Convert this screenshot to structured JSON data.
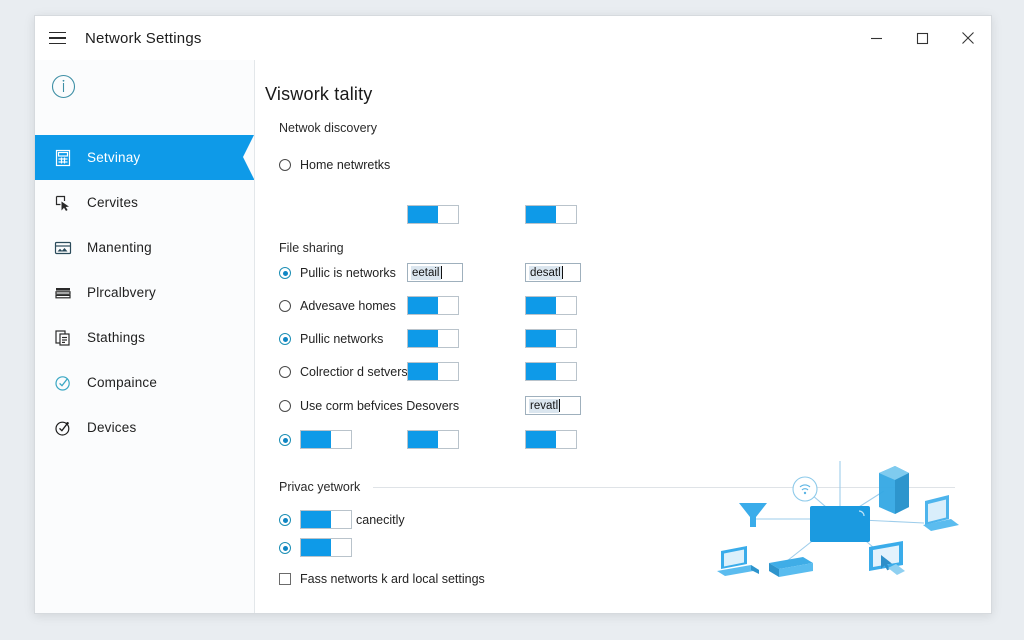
{
  "window": {
    "title": "Network Settings",
    "menu_icon": "hamburger-icon",
    "controls": {
      "minimize": "minimize-icon",
      "maximize": "maximize-icon",
      "close": "close-icon"
    }
  },
  "sidebar": {
    "info_icon": "info-circle-icon",
    "items": [
      {
        "label": "Setvinay",
        "icon": "calculator-icon",
        "active": true
      },
      {
        "label": "Cervites",
        "icon": "cursor-click-icon",
        "active": false
      },
      {
        "label": "Manenting",
        "icon": "card-image-icon",
        "active": false
      },
      {
        "label": "Plrcalbvery",
        "icon": "layers-stack-icon",
        "active": false
      },
      {
        "label": "Stathings",
        "icon": "copy-document-icon",
        "active": false
      },
      {
        "label": "Compaince",
        "icon": "check-circle-icon",
        "active": false
      },
      {
        "label": "Devices",
        "icon": "check-circle-dot-icon",
        "active": false
      }
    ]
  },
  "main": {
    "page_title": "Viswork tality",
    "sections": {
      "discovery_label": "Netwok discovery",
      "file_sharing_label": "File sharing",
      "privacy_label": "Privac yetwork"
    },
    "rows": {
      "home_networks": "Home netwretks",
      "public_is_networks": "Pullic is networks",
      "advesave_homes": "Advesave homes",
      "public_networks": "Pullic networks",
      "collection_servers": "Colrectior d setvers",
      "use_com_services": "Use corm befvices Desovers",
      "capacity": "canecitly",
      "pass_networks": "Fass networts k ard local settings"
    },
    "fields": {
      "field_1": "eetail",
      "field_2": "desatl",
      "field_3": "revatl"
    },
    "illustration": "network-topology-diagram"
  },
  "colors": {
    "accent": "#0e9ae8",
    "teal": "#1d8fb5",
    "text": "#232323"
  }
}
